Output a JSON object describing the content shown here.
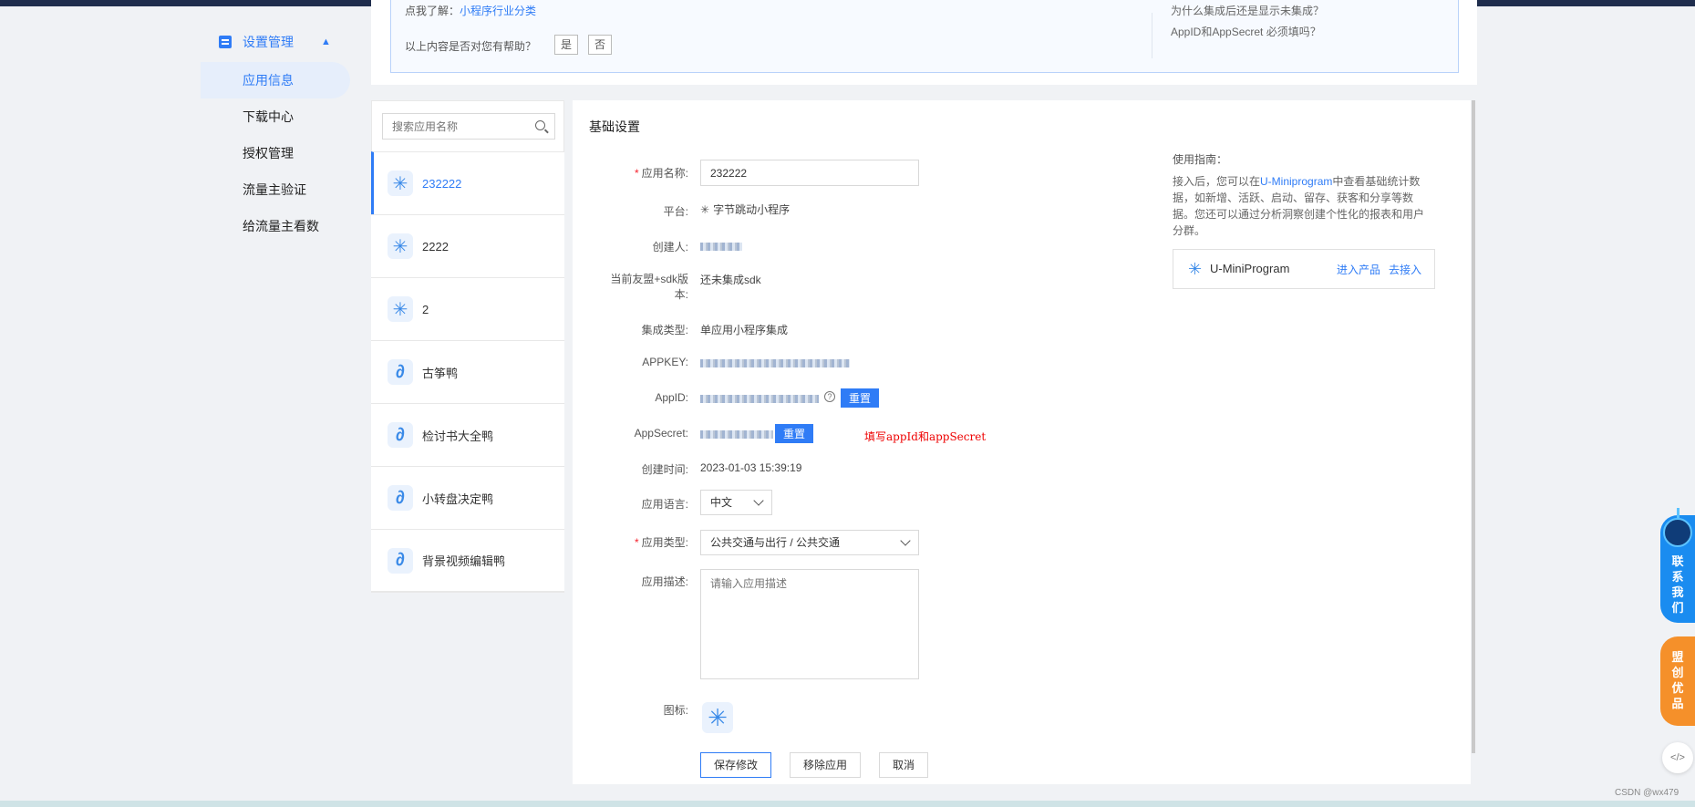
{
  "feedback": {
    "line1_prefix": "点我了解：",
    "line1_link": "小程序行业分类",
    "question": "以上内容是否对您有帮助？",
    "yes": "是",
    "no": "否",
    "link1": "为什么集成后还是显示未集成？",
    "link2": "AppID和AppSecret 必须填吗？"
  },
  "sidebar": {
    "group": "设置管理",
    "items": [
      {
        "label": "应用信息"
      },
      {
        "label": "下载中心"
      },
      {
        "label": "授权管理"
      },
      {
        "label": "流量主验证"
      },
      {
        "label": "给流量主看数"
      }
    ]
  },
  "search": {
    "placeholder": "搜索应用名称"
  },
  "apps": [
    {
      "label": "232222"
    },
    {
      "label": "2222"
    },
    {
      "label": "2"
    },
    {
      "label": "古筝鸭"
    },
    {
      "label": "检讨书大全鸭"
    },
    {
      "label": "小转盘决定鸭"
    },
    {
      "label": "背景视频编辑鸭"
    }
  ],
  "form": {
    "section_title": "基础设置",
    "name_label": "应用名称:",
    "name_value": "232222",
    "platform_label": "平台:",
    "platform_value": "字节跳动小程序",
    "creator_label": "创建人:",
    "sdk_label_1": "当前友盟+sdk版",
    "sdk_label_2": "本:",
    "sdk_value": "还未集成sdk",
    "integration_label": "集成类型:",
    "integration_value": "单应用小程序集成",
    "appkey_label": "APPKEY:",
    "appid_label": "AppID:",
    "appid_help": "?",
    "appsecret_label": "AppSecret:",
    "reset": "重置",
    "created_label": "创建时间:",
    "created_value": "2023-01-03 15:39:19",
    "lang_label": "应用语言:",
    "lang_value": "中文",
    "type_label": "应用类型:",
    "type_value": "公共交通与出行 / 公共交通",
    "desc_label": "应用描述:",
    "desc_placeholder": "请输入应用描述",
    "icon_label": "图标:",
    "save": "保存修改",
    "remove": "移除应用",
    "cancel": "取消",
    "annotation": "填写appId和appSecret"
  },
  "guide": {
    "title": "使用指南：",
    "text_1": "接入后，您可以在",
    "text_link": "U-Miniprogram",
    "text_2": "中查看基础统计数据，如新增、活跃、启动、留存、获客和分享等数据。您还可以通过分析洞察创建个性化的报表和用户分群。",
    "card_name": "U-MiniProgram",
    "card_link1": "进入产品",
    "card_link2": "去接入"
  },
  "floating": {
    "contact": "联系我们",
    "promo": "盟创优品",
    "code_icon": "</>"
  },
  "watermark": "CSDN @wx479",
  "colors": {
    "accent": "#2f7cf6",
    "annotation": "#e00000",
    "promo": "#f5902a",
    "contact": "#1a8cf0"
  }
}
